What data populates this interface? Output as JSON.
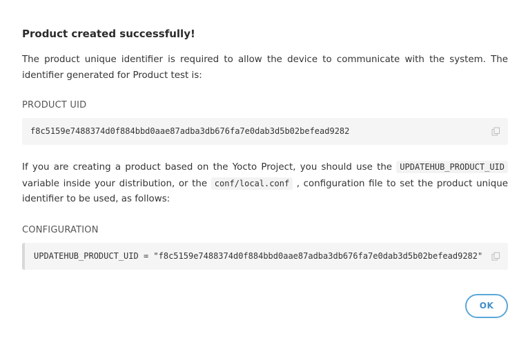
{
  "dialog": {
    "title": "Product created successfully!",
    "intro": "The product unique identifier is required to allow the device to communicate with the system. The identifier generated for Product test is:",
    "uid_label": "PRODUCT UID",
    "uid_value": "f8c5159e7488374d0f884bbd0aae87adba3db676fa7e0dab3d5b02befead9282",
    "instructions": {
      "part1": "If you are creating a product based on the Yocto Project, you should use the ",
      "code1": "UPDATEHUB_PRODUCT_UID",
      "part2": " variable inside your distribution, or the ",
      "code2": "conf/local.conf",
      "part3": " , configuration file to set the product unique identifier to be used, as follows:"
    },
    "config_label": "CONFIGURATION",
    "config_value": "UPDATEHUB_PRODUCT_UID = \"f8c5159e7488374d0f884bbd0aae87adba3db676fa7e0dab3d5b02befead9282\"",
    "copy_icon": "copy-icon",
    "ok_label": "OK"
  },
  "colors": {
    "accent": "#5aa6d8",
    "code_background": "#f5f5f5",
    "text": "#333333"
  }
}
